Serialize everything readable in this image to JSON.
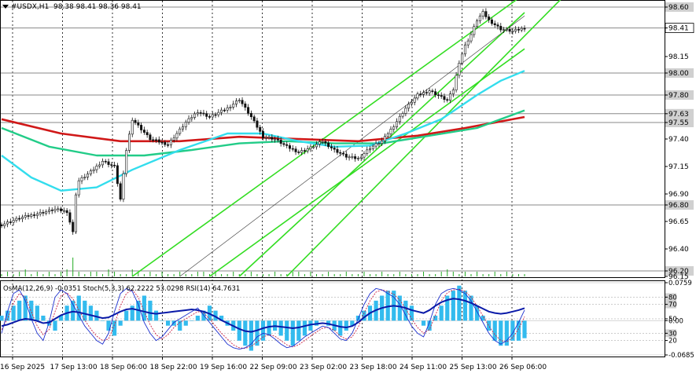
{
  "header": {
    "symbol": "#USDX,H1",
    "ohlc": "98.38 98.41 98.36 98.41"
  },
  "indicator_header": "OsMA(12,26,9) -0.0351  Stoch(5,3,3) 62.2222 53.0298  RSI(14) 64.7631",
  "colors": {
    "ema_red": "#d01818",
    "ema_green": "#22cc88",
    "ema_cyan": "#33dded",
    "channel": "#33dd22",
    "candle": "#111111",
    "level_line": "#888888",
    "osma_hist": "#33bbee",
    "stoch_main": "#1c2fcf",
    "stoch_signal": "#cc2244",
    "rsi": "#0a1aa8",
    "volume": "#22aa22"
  },
  "chart_data": [
    {
      "type": "candlestick",
      "title": "#USDX,H1",
      "y_ticks": [
        "98.60",
        "98.41",
        "98.15",
        "98.00",
        "97.80",
        "97.63",
        "97.55",
        "97.40",
        "97.15",
        "96.90",
        "96.80",
        "96.65",
        "96.40",
        "96.20",
        "96.15"
      ],
      "highlighted_levels": [
        "98.60",
        "98.41",
        "98.00",
        "97.80",
        "97.63",
        "97.55",
        "96.80",
        "96.20"
      ],
      "current_price": "98.41",
      "ylim": [
        96.15,
        98.65
      ],
      "x_ticks": [
        "16 Sep 2025",
        "17 Sep 13:00",
        "18 Sep 06:00",
        "18 Sep 22:00",
        "19 Sep 16:00",
        "22 Sep 09:00",
        "23 Sep 02:00",
        "23 Sep 18:00",
        "24 Sep 11:00",
        "25 Sep 13:00",
        "26 Sep 06:00"
      ],
      "close_path": [
        [
          0,
          96.62
        ],
        [
          3,
          96.68
        ],
        [
          6,
          96.72
        ],
        [
          9,
          96.76
        ],
        [
          11,
          96.74
        ],
        [
          12,
          96.55
        ],
        [
          12.5,
          96.9
        ],
        [
          13,
          97.02
        ],
        [
          15,
          97.1
        ],
        [
          17,
          97.2
        ],
        [
          19,
          97.15
        ],
        [
          20,
          96.85
        ],
        [
          21,
          97.3
        ],
        [
          22,
          97.58
        ],
        [
          25,
          97.4
        ],
        [
          28,
          97.35
        ],
        [
          31,
          97.55
        ],
        [
          33,
          97.65
        ],
        [
          35,
          97.6
        ],
        [
          38,
          97.68
        ],
        [
          40,
          97.76
        ],
        [
          42,
          97.6
        ],
        [
          44,
          97.42
        ],
        [
          46,
          97.4
        ],
        [
          48,
          97.33
        ],
        [
          50,
          97.28
        ],
        [
          52,
          97.32
        ],
        [
          54,
          97.38
        ],
        [
          56,
          97.3
        ],
        [
          58,
          97.24
        ],
        [
          60,
          97.22
        ],
        [
          62,
          97.32
        ],
        [
          64,
          97.38
        ],
        [
          66,
          97.52
        ],
        [
          68,
          97.68
        ],
        [
          70,
          97.8
        ],
        [
          72,
          97.84
        ],
        [
          74,
          97.78
        ],
        [
          75,
          97.75
        ],
        [
          76,
          97.85
        ],
        [
          77,
          98.1
        ],
        [
          78,
          98.25
        ],
        [
          79,
          98.35
        ],
        [
          80,
          98.48
        ],
        [
          81,
          98.55
        ],
        [
          82,
          98.48
        ],
        [
          83,
          98.44
        ],
        [
          84,
          98.4
        ],
        [
          86,
          98.38
        ],
        [
          88,
          98.41
        ]
      ],
      "series": [
        {
          "name": "",
          "color": "#d01818",
          "points": [
            [
              0,
              97.58
            ],
            [
              10,
              97.45
            ],
            [
              20,
              97.38
            ],
            [
              30,
              97.38
            ],
            [
              40,
              97.42
            ],
            [
              50,
              97.4
            ],
            [
              60,
              97.38
            ],
            [
              70,
              97.43
            ],
            [
              78,
              97.5
            ],
            [
              88,
              97.6
            ]
          ]
        },
        {
          "name": "",
          "color": "#22cc88",
          "points": [
            [
              0,
              97.5
            ],
            [
              8,
              97.33
            ],
            [
              16,
              97.25
            ],
            [
              24,
              97.25
            ],
            [
              32,
              97.3
            ],
            [
              40,
              97.36
            ],
            [
              48,
              97.38
            ],
            [
              56,
              97.36
            ],
            [
              64,
              97.36
            ],
            [
              72,
              97.43
            ],
            [
              80,
              97.5
            ],
            [
              88,
              97.66
            ]
          ]
        },
        {
          "name": "",
          "color": "#33dded",
          "points": [
            [
              0,
              97.25
            ],
            [
              5,
              97.05
            ],
            [
              10,
              96.93
            ],
            [
              16,
              96.96
            ],
            [
              22,
              97.12
            ],
            [
              30,
              97.3
            ],
            [
              38,
              97.45
            ],
            [
              44,
              97.45
            ],
            [
              50,
              97.38
            ],
            [
              56,
              97.33
            ],
            [
              62,
              97.34
            ],
            [
              68,
              97.45
            ],
            [
              74,
              97.58
            ],
            [
              80,
              97.8
            ],
            [
              84,
              97.93
            ],
            [
              88,
              98.02
            ]
          ]
        }
      ],
      "channel_lines": [
        {
          "name": "",
          "points": [
            [
              22,
              96.15
            ],
            [
              88,
              98.72
            ]
          ]
        },
        {
          "name": "",
          "points": [
            [
              35,
              96.15
            ],
            [
              88,
              98.22
            ]
          ]
        },
        {
          "name": "",
          "points": [
            [
              40,
              96.15
            ],
            [
              88,
              98.55
            ]
          ]
        },
        {
          "name": "",
          "points": [
            [
              48,
              96.15
            ],
            [
              95,
              98.72
            ]
          ]
        }
      ],
      "volume": [
        1,
        2,
        1,
        2,
        3,
        1,
        2,
        1,
        2,
        1,
        2,
        3,
        8,
        2,
        1,
        2,
        2,
        1,
        3,
        2,
        1,
        1,
        3,
        2,
        1,
        2,
        1,
        2,
        1,
        1,
        2,
        1,
        1,
        2,
        2,
        1,
        2,
        1,
        1,
        2,
        1,
        1,
        2,
        1,
        1,
        1,
        2,
        1,
        1,
        2,
        2,
        1,
        2,
        1,
        1,
        2,
        1,
        1,
        2,
        1,
        1,
        2,
        1,
        1,
        2,
        1,
        1,
        2,
        1,
        1,
        1,
        2,
        1,
        1,
        2,
        3,
        2,
        1,
        2,
        1,
        2,
        1,
        1,
        2,
        1,
        2,
        1,
        1,
        1
      ]
    },
    {
      "type": "indicator",
      "title": "OsMA(12,26,9) -0.0351  Stoch(5,3,3) 62.2222 53.0298  RSI(14) 64.7631",
      "y_ticks": [
        "0.0759",
        "80",
        "70",
        "50",
        "0.00",
        "30",
        "20",
        "-0.0685"
      ],
      "ylim": [
        -0.0685,
        0.0759
      ],
      "osma": [
        0.01,
        0.02,
        0.03,
        0.04,
        0.05,
        0.04,
        0.03,
        0.01,
        -0.01,
        -0.02,
        0.01,
        0.03,
        0.04,
        0.05,
        0.04,
        0.03,
        0.02,
        0.0,
        -0.02,
        -0.03,
        -0.01,
        0.02,
        0.03,
        0.04,
        0.05,
        0.04,
        0.02,
        0.0,
        -0.01,
        -0.01,
        -0.02,
        -0.01,
        0.0,
        0.01,
        0.02,
        0.03,
        0.02,
        0.01,
        -0.01,
        -0.02,
        -0.04,
        -0.05,
        -0.06,
        -0.05,
        -0.04,
        -0.03,
        -0.02,
        -0.03,
        -0.04,
        -0.05,
        -0.04,
        -0.03,
        -0.02,
        -0.01,
        0.0,
        -0.01,
        -0.02,
        -0.03,
        -0.02,
        -0.01,
        0.01,
        0.02,
        0.03,
        0.04,
        0.05,
        0.06,
        0.06,
        0.05,
        0.04,
        0.03,
        0.0,
        -0.01,
        -0.02,
        0.01,
        0.03,
        0.05,
        0.06,
        0.07,
        0.06,
        0.05,
        0.03,
        0.01,
        -0.02,
        -0.04,
        -0.05,
        -0.05,
        -0.04,
        -0.04,
        -0.035
      ],
      "stoch_main": [
        30,
        60,
        85,
        90,
        75,
        50,
        30,
        20,
        45,
        80,
        90,
        85,
        70,
        55,
        40,
        30,
        20,
        15,
        30,
        60,
        85,
        92,
        88,
        70,
        45,
        30,
        20,
        25,
        35,
        45,
        50,
        55,
        60,
        65,
        55,
        45,
        35,
        25,
        15,
        10,
        8,
        10,
        15,
        25,
        30,
        28,
        22,
        15,
        10,
        12,
        18,
        25,
        30,
        35,
        40,
        38,
        30,
        22,
        20,
        30,
        50,
        70,
        85,
        92,
        90,
        85,
        80,
        70,
        55,
        40,
        30,
        25,
        45,
        70,
        85,
        90,
        92,
        90,
        85,
        75,
        60,
        45,
        30,
        20,
        15,
        20,
        30,
        45,
        62
      ],
      "stoch_signal": [
        35,
        50,
        72,
        85,
        80,
        60,
        40,
        28,
        35,
        60,
        82,
        86,
        78,
        62,
        48,
        36,
        26,
        20,
        22,
        42,
        68,
        85,
        90,
        80,
        60,
        42,
        28,
        22,
        28,
        38,
        45,
        50,
        55,
        60,
        58,
        50,
        40,
        30,
        22,
        14,
        10,
        9,
        12,
        18,
        25,
        28,
        26,
        20,
        14,
        11,
        14,
        20,
        26,
        32,
        37,
        38,
        34,
        26,
        22,
        25,
        38,
        58,
        75,
        87,
        90,
        88,
        84,
        76,
        64,
        50,
        38,
        30,
        35,
        55,
        75,
        86,
        90,
        91,
        88,
        80,
        68,
        54,
        40,
        28,
        20,
        18,
        24,
        36,
        53
      ],
      "rsi": [
        40,
        42,
        45,
        48,
        50,
        49,
        47,
        44,
        45,
        50,
        55,
        58,
        60,
        59,
        57,
        55,
        53,
        51,
        52,
        56,
        60,
        63,
        64,
        62,
        60,
        58,
        57,
        58,
        59,
        60,
        61,
        62,
        63,
        62,
        60,
        57,
        53,
        48,
        44,
        40,
        36,
        33,
        32,
        34,
        37,
        39,
        40,
        39,
        38,
        37,
        38,
        40,
        42,
        43,
        44,
        43,
        41,
        39,
        38,
        40,
        45,
        52,
        58,
        62,
        65,
        67,
        68,
        67,
        65,
        62,
        60,
        58,
        62,
        68,
        73,
        76,
        78,
        77,
        75,
        72,
        68,
        64,
        60,
        58,
        57,
        58,
        60,
        62,
        64.76
      ]
    }
  ]
}
